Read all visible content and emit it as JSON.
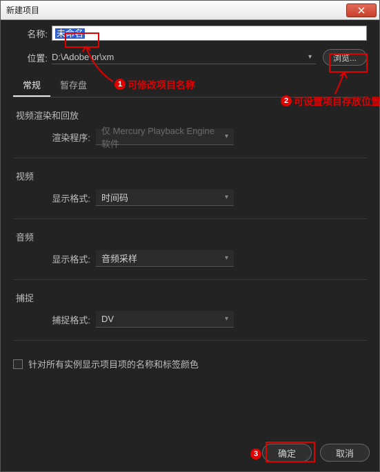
{
  "titlebar": {
    "title": "新建项目"
  },
  "name": {
    "label": "名称:",
    "value": "未命名"
  },
  "location": {
    "label": "位置:",
    "value": "D:\\Adobe pr\\xm",
    "browse": "浏览..."
  },
  "tabs": {
    "general": "常规",
    "scratch": "暂存盘"
  },
  "render": {
    "section": "视频渲染和回放",
    "renderer_label": "渲染程序:",
    "renderer_value": "仅 Mercury Playback Engine 软件"
  },
  "video": {
    "section": "视频",
    "format_label": "显示格式:",
    "format_value": "时间码"
  },
  "audio": {
    "section": "音频",
    "format_label": "显示格式:",
    "format_value": "音频采样"
  },
  "capture": {
    "section": "捕捉",
    "format_label": "捕捉格式:",
    "format_value": "DV"
  },
  "checkbox": {
    "label": "针对所有实例显示项目项的名称和标签颜色"
  },
  "footer": {
    "ok": "确定",
    "cancel": "取消"
  },
  "annotations": {
    "a1_num": "1",
    "a1_text": "可修改项目名称",
    "a2_num": "2",
    "a2_text": "可设置项目存放位置",
    "a3_num": "3"
  }
}
